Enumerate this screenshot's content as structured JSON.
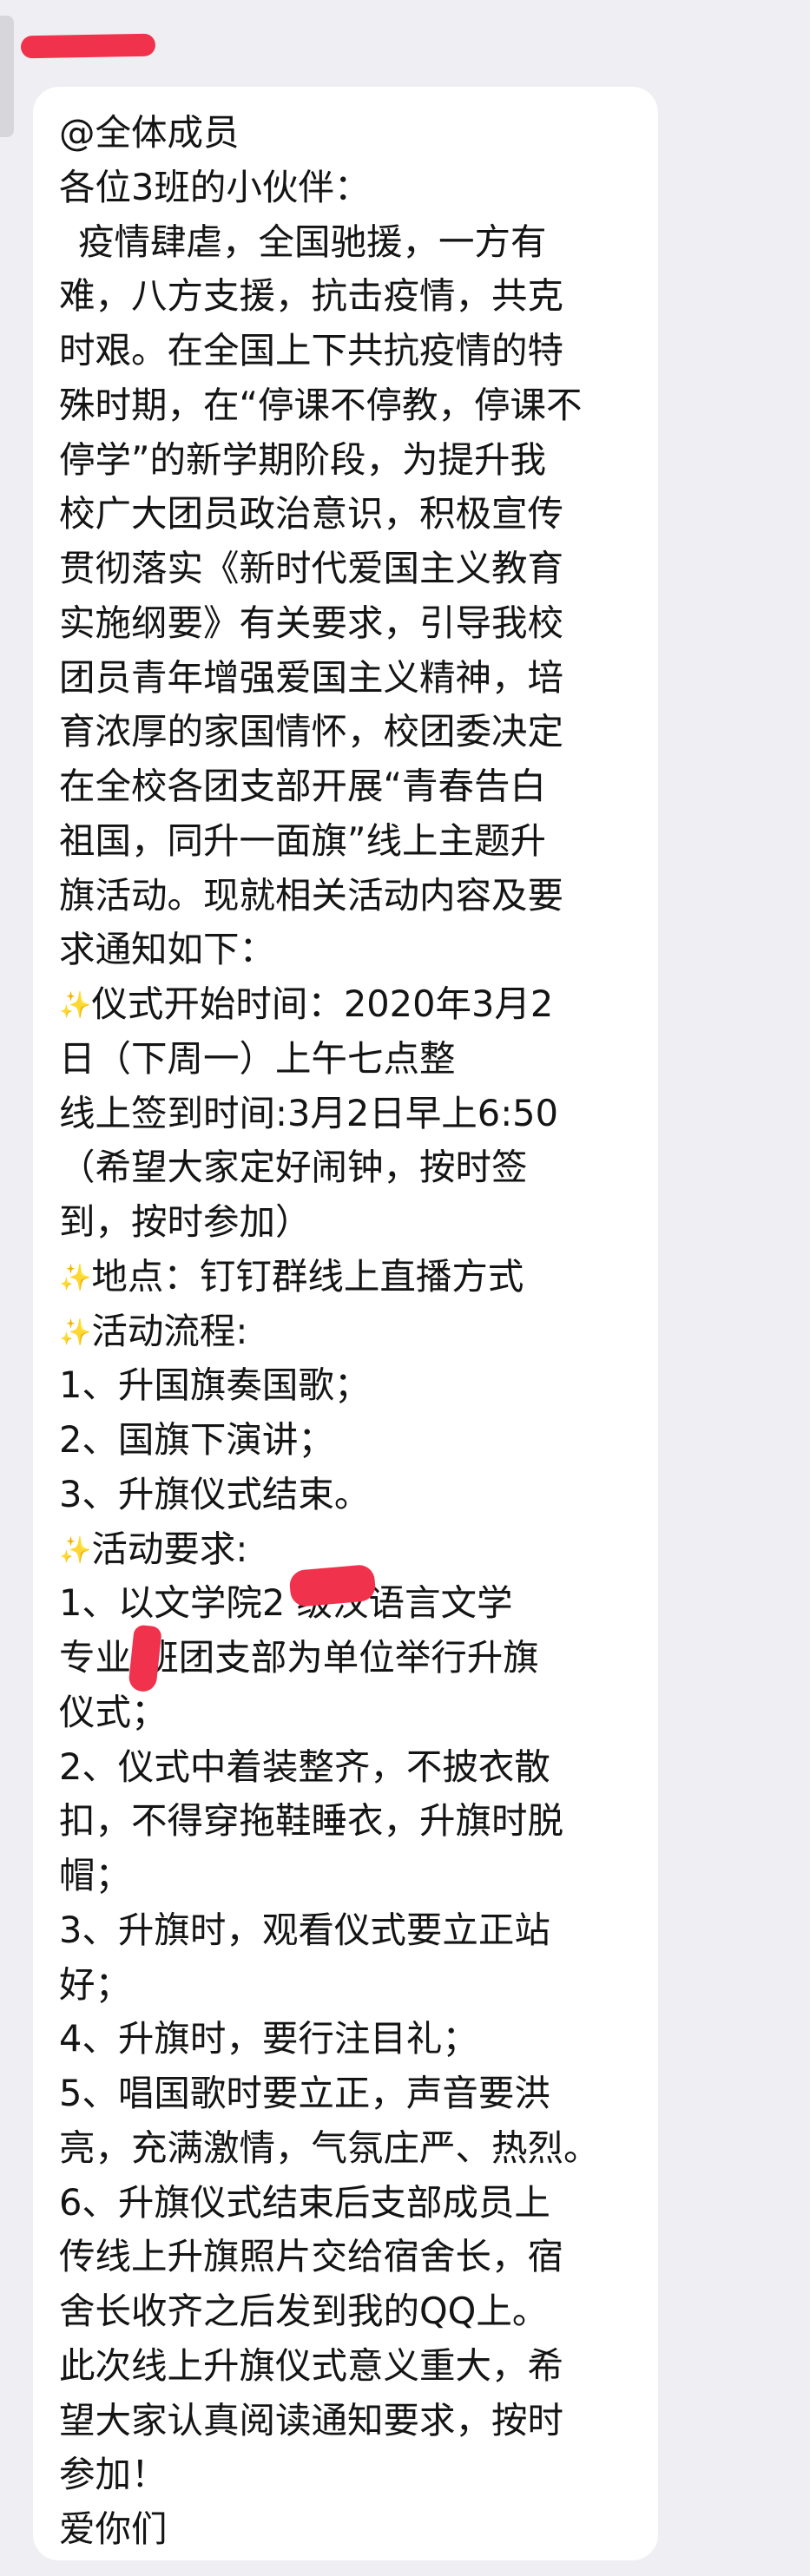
{
  "chat": {
    "sender_name": "Red redacted sender",
    "sender_name_display": "",
    "icons": {
      "sparkle": "sparkle-icon"
    },
    "message": {
      "lines": [
        "@全体成员",
        "各位3班的小伙伴：",
        "疫情肆虐，全国驰援，一方有",
        "难，八方支援，抗击疫情，共克",
        "时艰。在全国上下共抗疫情的特",
        "殊时期，在“停课不停教，停课不",
        "停学”的新学期阶段，为提升我",
        "校广大团员政治意识，积极宣传",
        "贯彻落实《新时代爱国主义教育",
        "实施纲要》有关要求，引导我校",
        "团员青年增强爱国主义精神，培",
        "育浓厚的家国情怀，校团委决定",
        "在全校各团支部开展“青春告白",
        "祖国，同升一面旗”线上主题升",
        "旗活动。现就相关活动内容及要",
        "求通知如下：",
        "仪式开始时间：2020年3月2",
        "日（下周一）上午七点整",
        "线上签到时间:3月2日早上6:50",
        "（希望大家定好闹钟，按时签",
        "到，按时参加）",
        "地点：钉钉群线上直播方式",
        "活动流程:",
        "1、升国旗奏国歌；",
        "2、国旗下演讲；",
        "3、升旗仪式结束。",
        "活动要求:",
        "1、以文学院2 级汉语言文学",
        "专业 班团支部为单位举行升旗",
        "仪式；",
        "2、仪式中着装整齐，不披衣散",
        "扣，不得穿拖鞋睡衣，升旗时脱",
        "帽；",
        "3、升旗时，观看仪式要立正站",
        "好；",
        "4、升旗时，要行注目礼；",
        "5、唱国歌时要立正，声音要洪",
        "亮，充满激情，气氛庄严、热烈。",
        "6、升旗仪式结束后支部成员上",
        "传线上升旗照片交给宿舍长，宿",
        "舍长收齐之后发到我的QQ上。",
        "此次线上升旗仪式意义重大，希",
        "望大家认真阅读通知要求，按时",
        "参加！",
        "爱你们"
      ]
    }
  },
  "colors": {
    "background": "#efeff3",
    "bubble": "#ffffff",
    "text": "#141414",
    "redaction": "#f0324c"
  }
}
